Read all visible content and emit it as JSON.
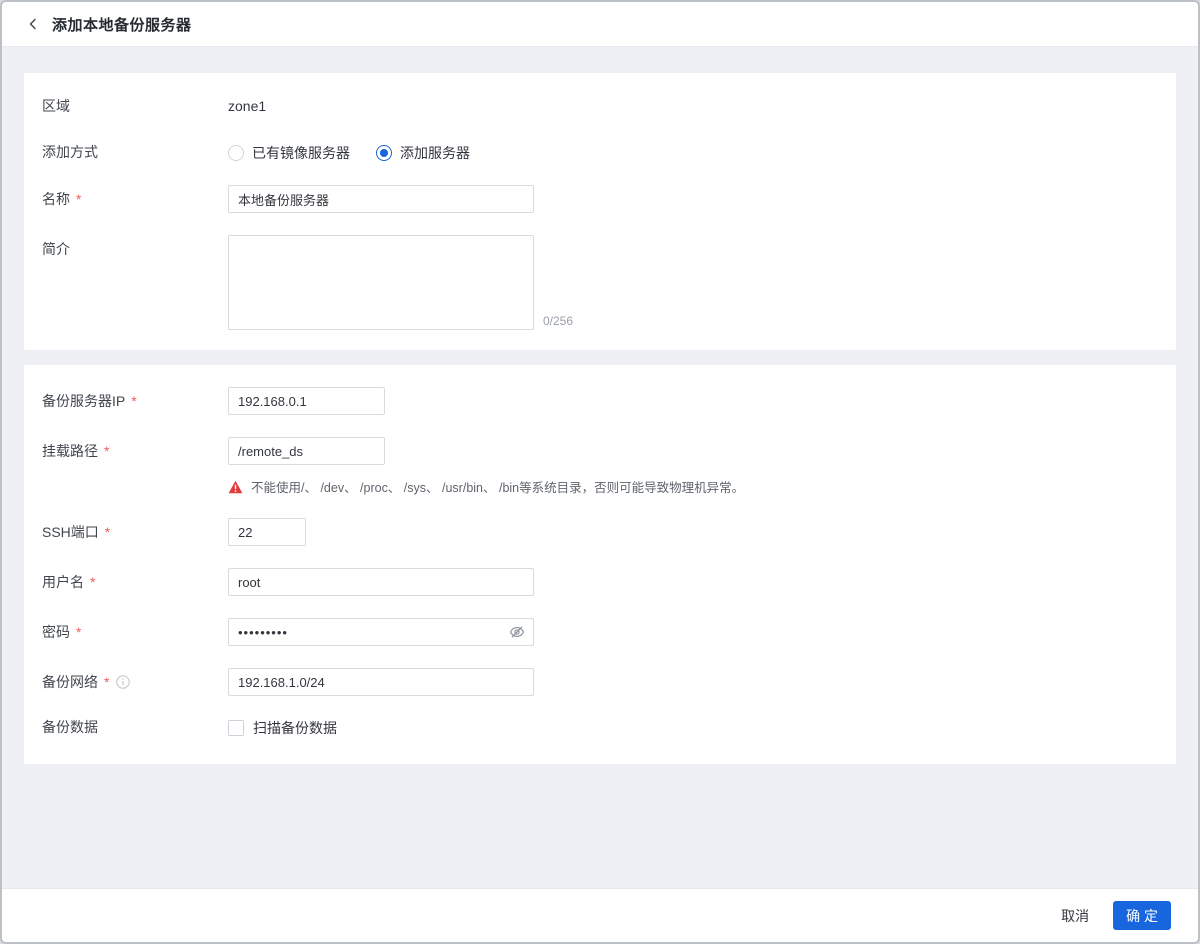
{
  "header": {
    "title": "添加本地备份服务器"
  },
  "form": {
    "zone": {
      "label": "区域",
      "value": "zone1"
    },
    "add_mode": {
      "label": "添加方式",
      "options": [
        {
          "label": "已有镜像服务器",
          "selected": false
        },
        {
          "label": "添加服务器",
          "selected": true
        }
      ]
    },
    "name": {
      "label": "名称",
      "required": "*",
      "value": "本地备份服务器"
    },
    "description": {
      "label": "简介",
      "value": "",
      "counter": "0/256"
    },
    "backup_ip": {
      "label": "备份服务器IP",
      "required": "*",
      "value": "192.168.0.1"
    },
    "mount_path": {
      "label": "挂载路径",
      "required": "*",
      "value": "/remote_ds",
      "warning": "不能使用/、 /dev、 /proc、 /sys、 /usr/bin、 /bin等系统目录，否则可能导致物理机异常。"
    },
    "ssh_port": {
      "label": "SSH端口",
      "required": "*",
      "value": "22"
    },
    "username": {
      "label": "用户名",
      "required": "*",
      "value": "root"
    },
    "password": {
      "label": "密码",
      "required": "*",
      "value": "•••••••••"
    },
    "backup_network": {
      "label": "备份网络",
      "required": "*",
      "value": "192.168.1.0/24"
    },
    "backup_data": {
      "label": "备份数据",
      "checkbox_label": "扫描备份数据",
      "checked": false
    }
  },
  "footer": {
    "cancel_label": "取消",
    "confirm_label": "确 定"
  },
  "colors": {
    "accent": "#1766dd",
    "danger": "#e23b3b",
    "required": "#f45b5b",
    "background": "#eef0f5"
  }
}
